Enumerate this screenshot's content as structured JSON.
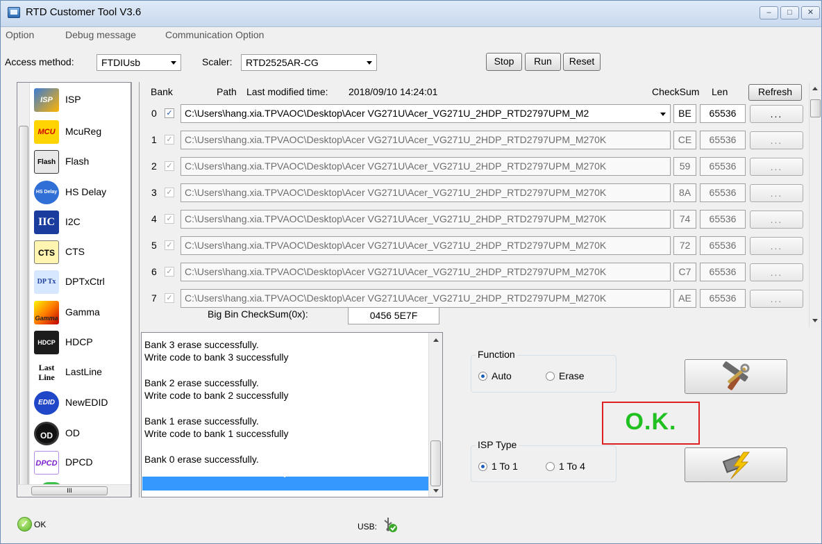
{
  "window": {
    "title": "RTD Customer Tool V3.6"
  },
  "menu": [
    "Option",
    "Debug message",
    "Communication Option"
  ],
  "toolbar": {
    "access_label": "Access method:",
    "access_value": "FTDIUsb",
    "scaler_label": "Scaler:",
    "scaler_value": "RTD2525AR-CG",
    "stop": "Stop",
    "run": "Run",
    "reset": "Reset"
  },
  "sidebar": {
    "items": [
      {
        "label": "ISP",
        "icon": "isp-icon",
        "badge": "ISP"
      },
      {
        "label": "McuReg",
        "icon": "mcu-icon",
        "badge": "MCU"
      },
      {
        "label": "Flash",
        "icon": "flash-icon",
        "badge": "Flash"
      },
      {
        "label": "HS Delay",
        "icon": "hs-delay-icon",
        "badge": "HS Delay"
      },
      {
        "label": "I2C",
        "icon": "iic-icon",
        "badge": "IIC"
      },
      {
        "label": "CTS",
        "icon": "cts-icon",
        "badge": "CTS"
      },
      {
        "label": "DPTxCtrl",
        "icon": "dptx-icon",
        "badge": "DP Tx"
      },
      {
        "label": "Gamma",
        "icon": "gamma-icon",
        "badge": "Gamma"
      },
      {
        "label": "HDCP",
        "icon": "hdcp-icon",
        "badge": "HDCP"
      },
      {
        "label": "LastLine",
        "icon": "lastline-icon",
        "badge": "Last Line"
      },
      {
        "label": "NewEDID",
        "icon": "edid-icon",
        "badge": "EDID"
      },
      {
        "label": "OD",
        "icon": "od-icon",
        "badge": "OD"
      },
      {
        "label": "DPCD",
        "icon": "dpcd-icon",
        "badge": "DPCD"
      }
    ],
    "scroll_glyph": "III"
  },
  "banks": {
    "header_bank": "Bank",
    "header_path": "Path",
    "last_modified_label": "Last modified time:",
    "last_modified_value": "2018/09/10 14:24:01",
    "header_checksum": "CheckSum",
    "header_len": "Len",
    "refresh": "Refresh",
    "rows": [
      {
        "num": "0",
        "checked": "✓",
        "path": "C:\\Users\\hang.xia.TPVAOC\\Desktop\\Acer VG271U\\Acer_VG271U_2HDP_RTD2797UPM_M2",
        "cs": "BE",
        "len": "65536",
        "dots": "...",
        "enabled": true
      },
      {
        "num": "1",
        "checked": "✓",
        "path": "C:\\Users\\hang.xia.TPVAOC\\Desktop\\Acer VG271U\\Acer_VG271U_2HDP_RTD2797UPM_M270K",
        "cs": "CE",
        "len": "65536",
        "dots": "...",
        "enabled": false
      },
      {
        "num": "2",
        "checked": "✓",
        "path": "C:\\Users\\hang.xia.TPVAOC\\Desktop\\Acer VG271U\\Acer_VG271U_2HDP_RTD2797UPM_M270K",
        "cs": "59",
        "len": "65536",
        "dots": "...",
        "enabled": false
      },
      {
        "num": "3",
        "checked": "✓",
        "path": "C:\\Users\\hang.xia.TPVAOC\\Desktop\\Acer VG271U\\Acer_VG271U_2HDP_RTD2797UPM_M270K",
        "cs": "8A",
        "len": "65536",
        "dots": "...",
        "enabled": false
      },
      {
        "num": "4",
        "checked": "✓",
        "path": "C:\\Users\\hang.xia.TPVAOC\\Desktop\\Acer VG271U\\Acer_VG271U_2HDP_RTD2797UPM_M270K",
        "cs": "74",
        "len": "65536",
        "dots": "...",
        "enabled": false
      },
      {
        "num": "5",
        "checked": "✓",
        "path": "C:\\Users\\hang.xia.TPVAOC\\Desktop\\Acer VG271U\\Acer_VG271U_2HDP_RTD2797UPM_M270K",
        "cs": "72",
        "len": "65536",
        "dots": "...",
        "enabled": false
      },
      {
        "num": "6",
        "checked": "✓",
        "path": "C:\\Users\\hang.xia.TPVAOC\\Desktop\\Acer VG271U\\Acer_VG271U_2HDP_RTD2797UPM_M270K",
        "cs": "C7",
        "len": "65536",
        "dots": "...",
        "enabled": false
      },
      {
        "num": "7",
        "checked": "✓",
        "path": "C:\\Users\\hang.xia.TPVAOC\\Desktop\\Acer VG271U\\Acer_VG271U_2HDP_RTD2797UPM_M270K",
        "cs": "AE",
        "len": "65536",
        "dots": "...",
        "enabled": false
      }
    ],
    "big_bin_label": "Big Bin CheckSum(0x):",
    "big_bin_value": "0456 5E7F"
  },
  "log": {
    "lines": [
      "Bank 3 erase successfully.",
      "Write code to bank 3 successfully",
      "",
      "Bank 2 erase successfully.",
      "Write code to bank 2 successfully",
      "",
      "Bank 1 erase successfully.",
      "Write code to bank 1 successfully",
      "",
      "Bank 0 erase successfully.",
      "Write code to bank 0 successfully"
    ]
  },
  "function_group": {
    "title": "Function",
    "auto": "Auto",
    "erase": "Erase",
    "selected": "Auto"
  },
  "isp_type_group": {
    "title": "ISP Type",
    "one_to_one": "1 To 1",
    "one_to_four": "1 To 4",
    "selected": "1 To 1"
  },
  "result": {
    "text": "O.K."
  },
  "status": {
    "ok": "OK",
    "usb_label": "USB:"
  },
  "colors": {
    "ok_green": "#20c020",
    "ok_border": "#e02020",
    "selection": "#3399ff"
  }
}
